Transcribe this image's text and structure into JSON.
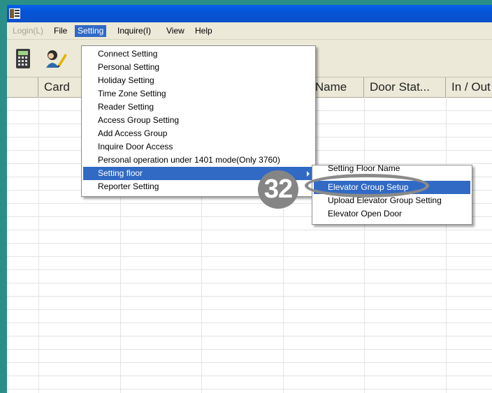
{
  "menubar": {
    "items": [
      {
        "label": "Login(L)",
        "state": "disabled"
      },
      {
        "label": "File",
        "state": "normal"
      },
      {
        "label": "Setting",
        "state": "active"
      },
      {
        "label": "Inquire(I)",
        "state": "normal"
      },
      {
        "label": "View",
        "state": "normal"
      },
      {
        "label": "Help",
        "state": "normal"
      }
    ]
  },
  "toolbar": {
    "buttons": [
      {
        "icon": "calculator-icon"
      },
      {
        "icon": "user-edit-icon"
      }
    ]
  },
  "grid": {
    "columns": [
      "",
      "Card",
      "",
      "",
      "or Name",
      "Door Stat...",
      "In / Out"
    ]
  },
  "setting_menu": {
    "items": [
      "Connect Setting",
      "Personal Setting",
      "Holiday Setting",
      "Time Zone Setting",
      "Reader Setting",
      "Access Group Setting",
      "Add Access Group",
      "Inquire Door Access",
      "Personal operation under 1401 mode(Only 3760)",
      "Setting floor",
      "Reporter Setting"
    ],
    "highlighted": "Setting floor"
  },
  "sub_menu": {
    "items": [
      "Setting Floor Name",
      "Elevator Group Setup",
      "Upload Elevator Group Setting",
      "Elevator Open Door"
    ],
    "highlighted": "Elevator Group Setup"
  },
  "callout": {
    "step": "32"
  },
  "colors": {
    "desktop": "#2a8f88",
    "titlebar": "#0454d8",
    "highlight": "#316ac5",
    "callout": "#858585"
  }
}
